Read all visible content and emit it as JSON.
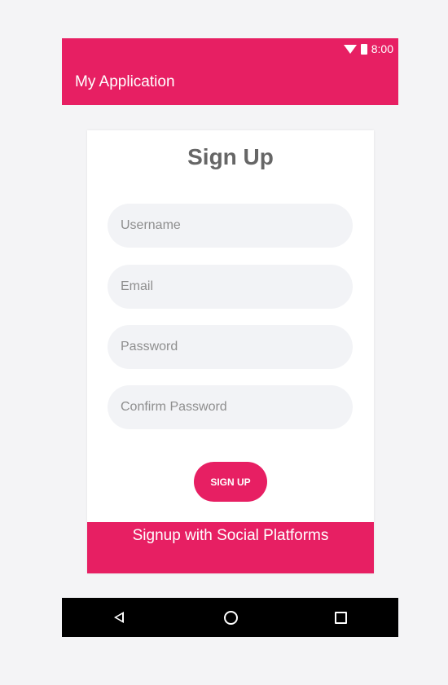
{
  "status_bar": {
    "time": "8:00",
    "wifi_icon": "wifi-icon",
    "battery_icon": "battery-icon"
  },
  "app_bar": {
    "title": "My Application"
  },
  "form": {
    "title": "Sign Up",
    "username": {
      "placeholder": "Username",
      "value": ""
    },
    "email": {
      "placeholder": "Email",
      "value": ""
    },
    "password": {
      "placeholder": "Password",
      "value": ""
    },
    "confirm_password": {
      "placeholder": "Confirm Password",
      "value": ""
    },
    "submit_label": "SIGN UP"
  },
  "social": {
    "label": "Signup with Social Platforms"
  },
  "nav_bar": {
    "back_icon": "back-triangle-icon",
    "home_icon": "home-circle-icon",
    "recents_icon": "recents-square-icon"
  },
  "colors": {
    "accent": "#e71f63",
    "background": "#f4f4f6",
    "card": "#ffffff",
    "field_bg": "#f2f3f6",
    "nav_bar": "#000000",
    "title_text": "#666666"
  }
}
